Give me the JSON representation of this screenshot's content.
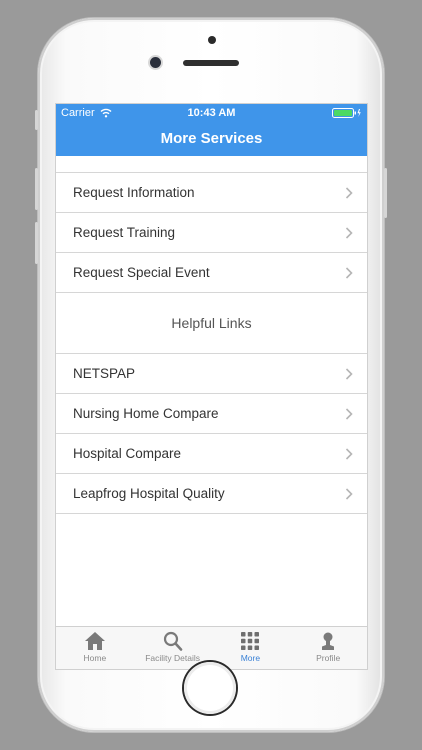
{
  "status_bar": {
    "carrier": "Carrier",
    "time": "10:43 AM"
  },
  "nav": {
    "title": "More Services"
  },
  "services": [
    {
      "label": "Request Information"
    },
    {
      "label": "Request Training"
    },
    {
      "label": "Request Special Event"
    }
  ],
  "helpful_links": {
    "header": "Helpful Links",
    "items": [
      {
        "label": "NETSPAP"
      },
      {
        "label": "Nursing Home Compare"
      },
      {
        "label": "Hospital Compare"
      },
      {
        "label": "Leapfrog Hospital Quality"
      }
    ]
  },
  "tabbar": {
    "items": [
      {
        "label": "Home",
        "icon": "house-icon"
      },
      {
        "label": "Facility Details",
        "icon": "search-icon"
      },
      {
        "label": "More",
        "icon": "grid-icon",
        "active": true
      },
      {
        "label": "Profile",
        "icon": "person-icon"
      }
    ]
  },
  "colors": {
    "nav_bar": "#3f95ea",
    "active_tab": "#3b82d6",
    "inactive_tab": "#8a8a8a",
    "battery": "#4cd964"
  }
}
